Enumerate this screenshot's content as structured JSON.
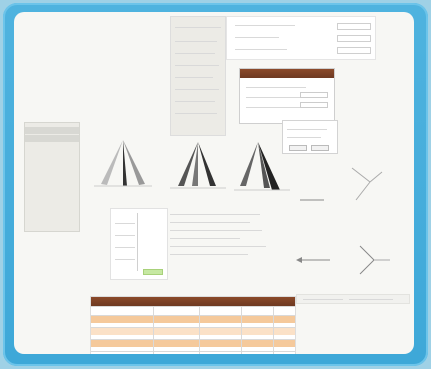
{
  "colors": {
    "frame": "#3ea8d8",
    "sheet": "#f7f7f4",
    "accent_brown": "#7a3f25",
    "orange_band": "#f5c99b"
  },
  "window": {
    "title": ""
  },
  "left_nav": {
    "items": [
      "",
      "",
      "",
      "",
      "",
      "",
      "",
      "",
      "",
      "",
      "",
      ""
    ]
  },
  "top_form": {
    "labels": [
      "",
      "",
      ""
    ]
  },
  "popup": {
    "title": ""
  },
  "figures": {
    "captions": [
      "",
      "",
      ""
    ]
  },
  "bottom_table": {
    "title": ""
  },
  "icons": [
    "tripod-icon",
    "tripod-icon",
    "tripod-icon",
    "arrow-icon",
    "branch-icon"
  ]
}
